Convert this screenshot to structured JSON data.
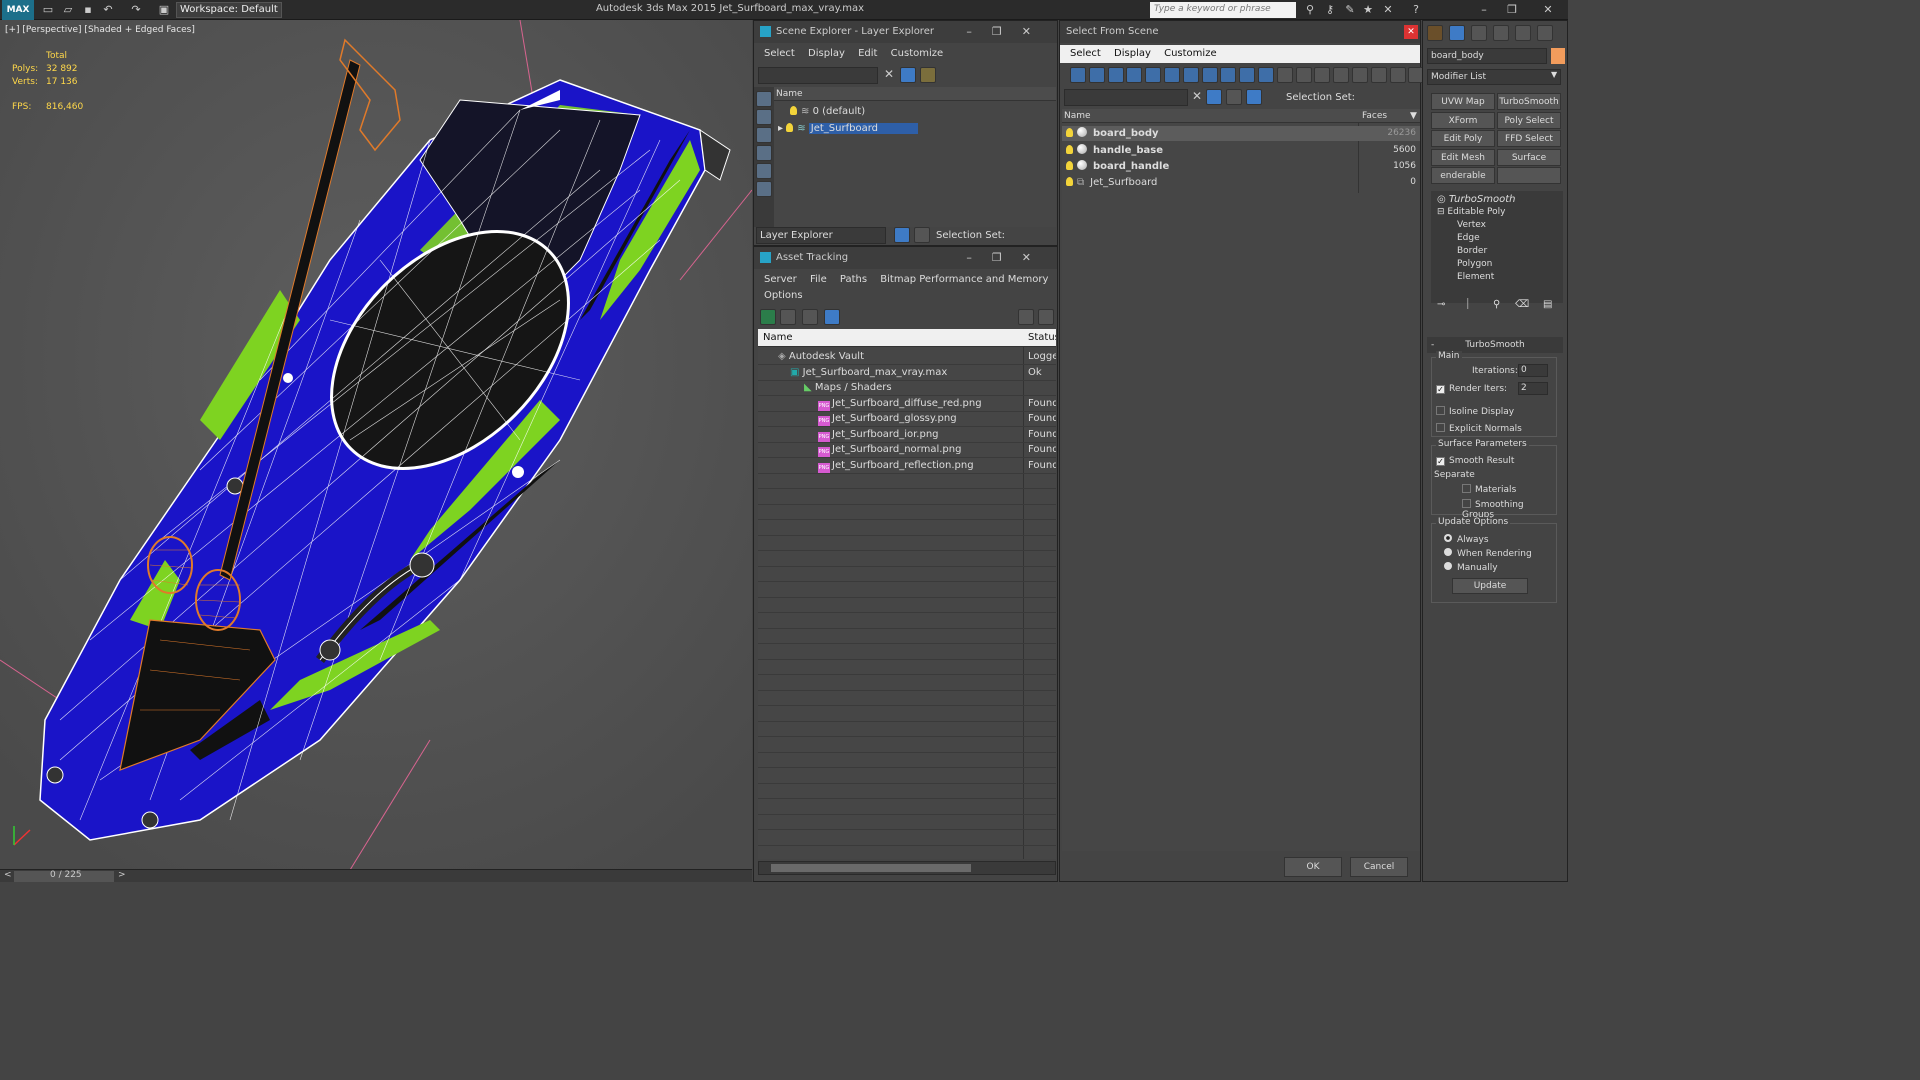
{
  "app": {
    "logo": "MAX",
    "workspace": "Workspace: Default",
    "title": "Autodesk 3ds Max  2015     Jet_Surfboard_max_vray.max",
    "search_placeholder": "Type a keyword or phrase"
  },
  "viewport": {
    "label": "[+] [Perspective] [Shaded + Edged Faces]",
    "stats": {
      "total": "Total",
      "polys_label": "Polys:",
      "polys": "32 892",
      "verts_label": "Verts:",
      "verts": "17 136",
      "fps_label": "FPS:",
      "fps": "816,460"
    },
    "timeline": "0 / 225"
  },
  "scene_explorer": {
    "title": "Scene Explorer - Layer Explorer",
    "menu": [
      "Select",
      "Display",
      "Edit",
      "Customize"
    ],
    "col_name": "Name",
    "rows": [
      "0 (default)",
      "Jet_Surfboard"
    ],
    "footer_mode": "Layer Explorer",
    "selection_set": "Selection Set:"
  },
  "asset_tracking": {
    "title": "Asset Tracking",
    "menu": [
      "Server",
      "File",
      "Paths",
      "Bitmap Performance and Memory"
    ],
    "menu2": "Options",
    "cols": [
      "Name",
      "Status"
    ],
    "rows": [
      {
        "name": "Autodesk Vault",
        "status": "Logge"
      },
      {
        "name": "Jet_Surfboard_max_vray.max",
        "status": "Ok"
      },
      {
        "name": "Maps / Shaders",
        "status": ""
      },
      {
        "name": "Jet_Surfboard_diffuse_red.png",
        "status": "Found"
      },
      {
        "name": "Jet_Surfboard_glossy.png",
        "status": "Found"
      },
      {
        "name": "Jet_Surfboard_ior.png",
        "status": "Found"
      },
      {
        "name": "Jet_Surfboard_normal.png",
        "status": "Found"
      },
      {
        "name": "Jet_Surfboard_reflection.png",
        "status": "Found"
      }
    ]
  },
  "select_from_scene": {
    "title": "Select From Scene",
    "menu": [
      "Select",
      "Display",
      "Customize"
    ],
    "selection_set": "Selection Set:",
    "cols": [
      "Name",
      "Faces"
    ],
    "rows": [
      {
        "name": "board_body",
        "faces": "26236"
      },
      {
        "name": "handle_base",
        "faces": "5600"
      },
      {
        "name": "board_handle",
        "faces": "1056"
      },
      {
        "name": "Jet_Surfboard",
        "faces": "0"
      }
    ],
    "ok": "OK",
    "cancel": "Cancel"
  },
  "command_panel": {
    "object_name": "board_body",
    "modifier_list": "Modifier List",
    "buttons": [
      "UVW Map",
      "TurboSmooth",
      "XForm",
      "Poly Select",
      "Edit Poly",
      "FFD Select",
      "Edit Mesh",
      "Surface Select",
      "enderable Splin",
      ""
    ],
    "stack": [
      "TurboSmooth",
      "Editable Poly",
      "Vertex",
      "Edge",
      "Border",
      "Polygon",
      "Element"
    ],
    "rollout_title": "TurboSmooth",
    "main": "Main",
    "iterations_label": "Iterations:",
    "iterations": "0",
    "render_iters_label": "Render Iters:",
    "render_iters": "2",
    "isoline": "Isoline Display",
    "explicit": "Explicit Normals",
    "surface_params": "Surface Parameters",
    "smooth_result": "Smooth Result",
    "separate": "Separate",
    "materials": "Materials",
    "smoothing_groups": "Smoothing Groups",
    "update_options": "Update Options",
    "always": "Always",
    "when_rendering": "When Rendering",
    "manually": "Manually",
    "update": "Update"
  },
  "colors": {
    "board_blue": "#1a14c8",
    "stripe_green": "#7ed321",
    "wire": "#ffffff",
    "paddle_orange": "#e07a2a",
    "selection": "#2e5fa8"
  }
}
